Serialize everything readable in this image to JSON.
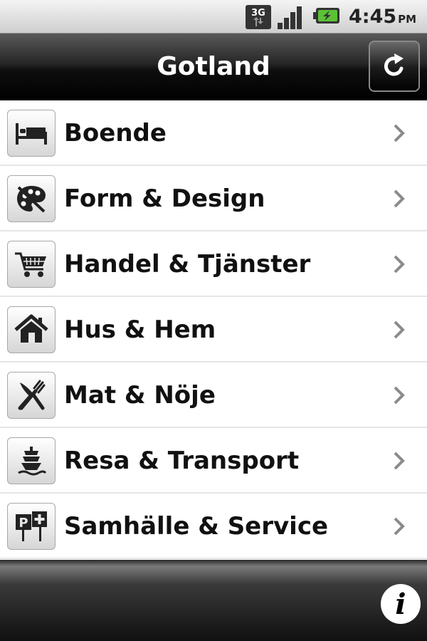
{
  "status_bar": {
    "network_label": "3G",
    "network_icon": "3g-data-icon",
    "signal_icon": "signal-icon",
    "battery_icon": "battery-charging-icon",
    "time": "4:45",
    "ampm": "PM"
  },
  "header": {
    "title": "Gotland",
    "refresh_icon": "refresh-icon"
  },
  "categories": [
    {
      "label": "Boende",
      "icon": "bed-icon"
    },
    {
      "label": "Form & Design",
      "icon": "palette-icon"
    },
    {
      "label": "Handel & Tjänster",
      "icon": "shopping-cart-icon"
    },
    {
      "label": "Hus & Hem",
      "icon": "house-icon"
    },
    {
      "label": "Mat & Nöje",
      "icon": "fork-knife-icon"
    },
    {
      "label": "Resa & Transport",
      "icon": "ferry-icon"
    },
    {
      "label": "Samhälle & Service",
      "icon": "service-sign-icon"
    }
  ],
  "footer": {
    "info_label": "i",
    "info_icon": "info-icon"
  },
  "colors": {
    "battery_green": "#5bc236",
    "title_text": "#ffffff",
    "chevron": "#8a8a8a"
  }
}
